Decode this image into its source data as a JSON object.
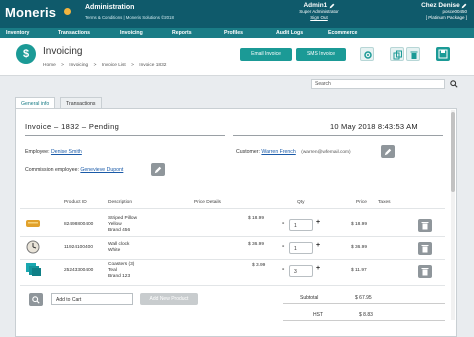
{
  "header": {
    "brand": "Moneris",
    "app_title": "Administration",
    "app_sub": "Terms & Conditions | Moneris Solutions ©2018",
    "user_name": "Admin1",
    "user_role": "Super Administrator",
    "user_signout": "Sign Out",
    "store_name": "Chez Denise",
    "store_id": "posce00450",
    "store_package": "[ Platinum Package ]"
  },
  "nav": [
    "Inventory",
    "Transactions",
    "Invoicing",
    "Reports",
    "Profiles",
    "Audit Logs",
    "Ecommerce"
  ],
  "title": {
    "icon": "$",
    "page": "Invoicing",
    "breadcrumb": [
      "Home",
      ">",
      "Invoicing",
      ">",
      "Invoice List",
      ">",
      "Invoice 1832"
    ],
    "email_btn": "Email Invoice",
    "sms_btn": "SMS Invoice"
  },
  "search": {
    "placeholder": "Search"
  },
  "tabs": [
    "General info",
    "Transactions"
  ],
  "invoice": {
    "title": "Invoice  –  1832  –  Pending",
    "date": "10 May 2018  8:43:53 AM",
    "employee_label": "Employee:",
    "employee": "Denise Smith",
    "commission_label": "Commission employee:",
    "commission": "Genevieve Dupont",
    "customer_label": "Customer:",
    "customer": "Warren French",
    "customer_email": "(warren@wfemail.com)"
  },
  "table": {
    "headers": [
      "Product ID",
      "Description",
      "Price Details",
      "Qty",
      "Price",
      "Taxes"
    ],
    "rows": [
      {
        "id": "82498800400",
        "desc": [
          "Striped Pillow",
          "Yellow",
          "Brand 456"
        ],
        "price_detail": "$ 18.99",
        "qty": "1",
        "price": "$ 18.99",
        "thumb": "pillow-icon"
      },
      {
        "id": "11924100400",
        "desc": [
          "Wall clock",
          "White"
        ],
        "price_detail": "$ 36.99",
        "qty": "1",
        "price": "$ 36.99",
        "thumb": "clock-icon"
      },
      {
        "id": "25243300400",
        "desc": [
          "Coasters (3)",
          "Teal",
          "Brand 123"
        ],
        "price_detail": "$ 3.99",
        "qty": "3",
        "price": "$ 11.97",
        "thumb": "coasters-icon"
      }
    ]
  },
  "bottom": {
    "add_to_cart": "Add to Cart",
    "new_product": "Add New Product",
    "subtotal_label": "Subtotal",
    "subtotal": "$ 67.95",
    "hst_label": "HST",
    "hst": "$ 8.83"
  },
  "colors": {
    "header": "#0f5a6b",
    "nav": "#1a7c86",
    "accent": "#1b9a96",
    "link": "#1a5aa8"
  }
}
